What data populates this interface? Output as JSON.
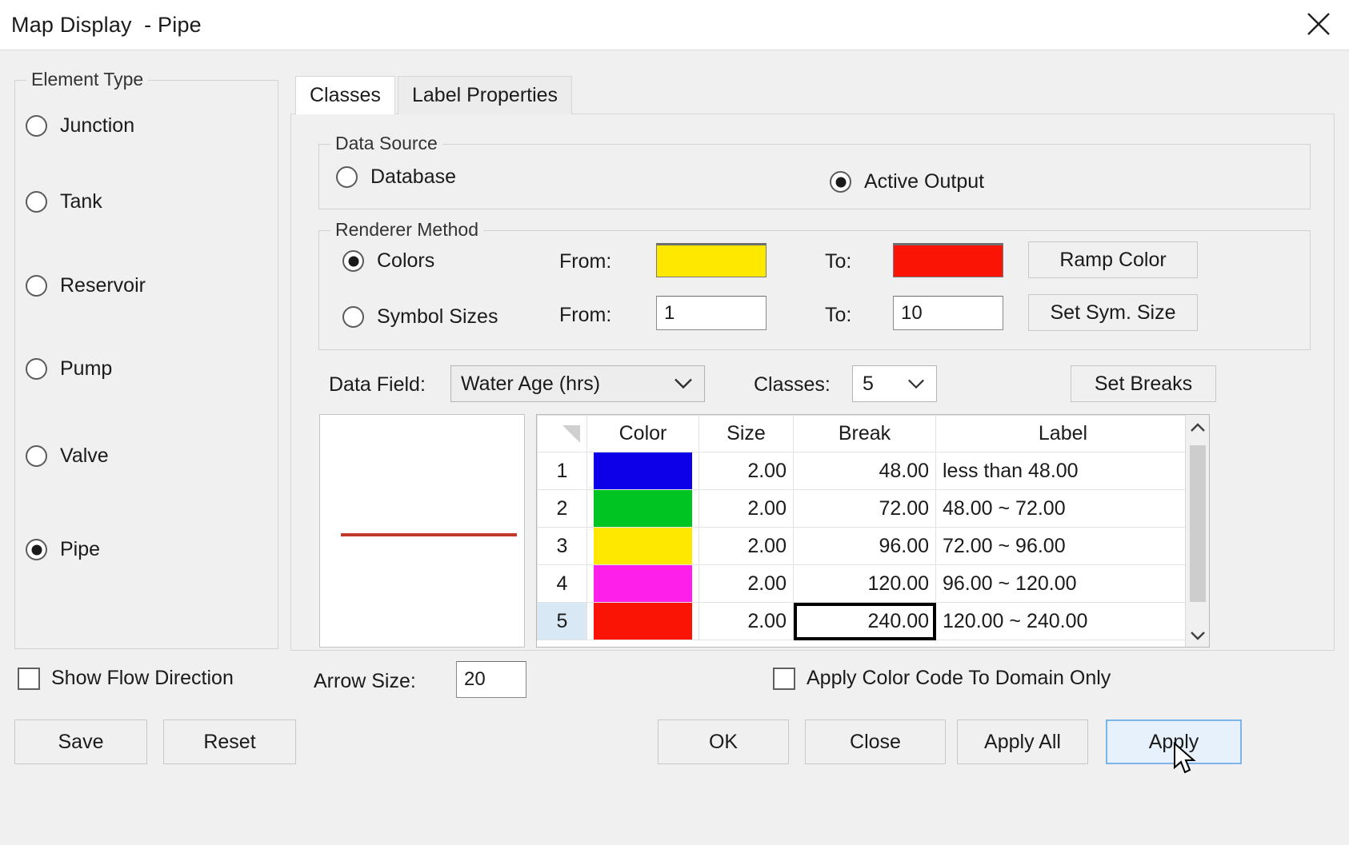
{
  "window": {
    "title": "Map Display  - Pipe",
    "close_icon": "close-icon"
  },
  "element_type": {
    "legend": "Element Type",
    "items": [
      {
        "label": "Junction",
        "selected": false
      },
      {
        "label": "Tank",
        "selected": false
      },
      {
        "label": "Reservoir",
        "selected": false
      },
      {
        "label": "Pump",
        "selected": false
      },
      {
        "label": "Valve",
        "selected": false
      },
      {
        "label": "Pipe",
        "selected": true
      }
    ]
  },
  "tabs": [
    {
      "label": "Classes",
      "active": true
    },
    {
      "label": "Label Properties",
      "active": false
    }
  ],
  "data_source": {
    "legend": "Data Source",
    "options": [
      {
        "label": "Database",
        "selected": false
      },
      {
        "label": "Active Output",
        "selected": true
      }
    ]
  },
  "renderer_method": {
    "legend": "Renderer Method",
    "colors": {
      "label": "Colors",
      "selected": true,
      "from_label": "From:",
      "from_color": "#FFE800",
      "to_label": "To:",
      "to_color": "#FA1405",
      "button": "Ramp Color"
    },
    "symbol_sizes": {
      "label": "Symbol Sizes",
      "selected": false,
      "from_label": "From:",
      "from_value": "1",
      "to_label": "To:",
      "to_value": "10",
      "button": "Set Sym. Size"
    }
  },
  "data_field": {
    "label": "Data Field:",
    "value": "Water Age (hrs)"
  },
  "classes_count": {
    "label": "Classes:",
    "value": "5"
  },
  "set_breaks_button": "Set Breaks",
  "preview": {
    "line_color": "#c0392b"
  },
  "classes_table": {
    "columns": [
      "",
      "Color",
      "Size",
      "Break",
      "Label"
    ],
    "rows": [
      {
        "index": "1",
        "color": "#0D00E8",
        "size": "2.00",
        "break": "48.00",
        "label": "less than 48.00",
        "selected": false,
        "break_focused": false
      },
      {
        "index": "2",
        "color": "#00C422",
        "size": "2.00",
        "break": "72.00",
        "label": "48.00 ~ 72.00",
        "selected": false,
        "break_focused": false
      },
      {
        "index": "3",
        "color": "#FFE800",
        "size": "2.00",
        "break": "96.00",
        "label": "72.00 ~ 96.00",
        "selected": false,
        "break_focused": false
      },
      {
        "index": "4",
        "color": "#FF1FEA",
        "size": "2.00",
        "break": "120.00",
        "label": "96.00 ~ 120.00",
        "selected": false,
        "break_focused": false
      },
      {
        "index": "5",
        "color": "#FA1405",
        "size": "2.00",
        "break": "240.00",
        "label": "120.00 ~ 240.00",
        "selected": true,
        "break_focused": true
      }
    ]
  },
  "footer": {
    "show_flow_direction": {
      "label": "Show Flow Direction",
      "checked": false
    },
    "arrow_size": {
      "label": "Arrow Size:",
      "value": "20"
    },
    "apply_color_code": {
      "label": "Apply Color Code To Domain Only",
      "checked": false
    }
  },
  "buttons": {
    "save": "Save",
    "reset": "Reset",
    "ok": "OK",
    "close": "Close",
    "apply_all": "Apply All",
    "apply": "Apply"
  }
}
